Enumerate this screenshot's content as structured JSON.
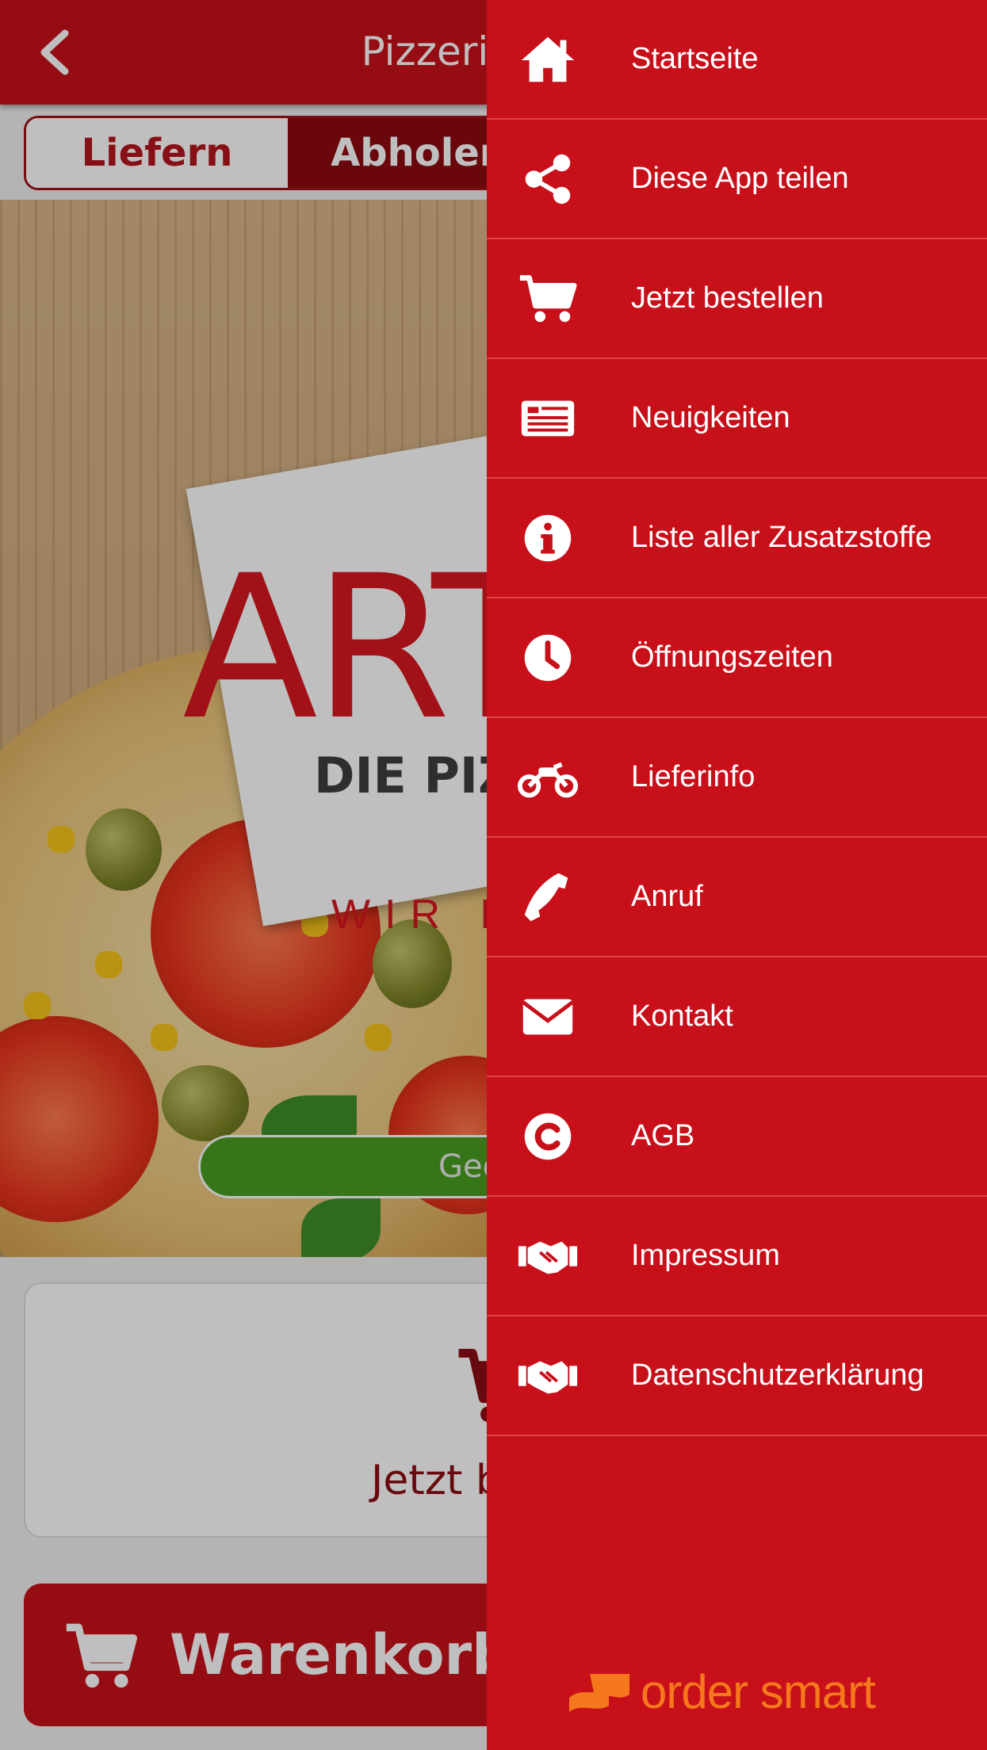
{
  "app": {
    "title": "Pizzeria Artur",
    "toggle": {
      "option_delivery": "Liefern",
      "option_pickup": "Abholen",
      "selected": "Abholen"
    },
    "hero": {
      "logo_text": "ARTUR",
      "logo_subtitle": "DIE PIZZERIA",
      "logo_tagline": "WIR B",
      "status": "Geö"
    },
    "order_card": {
      "label": "Jetzt bestellen",
      "icon": "cart-icon"
    },
    "basket_button": {
      "label": "Warenkorb",
      "icon": "cart-icon"
    }
  },
  "drawer": {
    "items": [
      {
        "label": "Startseite",
        "icon": "home-icon"
      },
      {
        "label": "Diese App teilen",
        "icon": "share-icon"
      },
      {
        "label": "Jetzt bestellen",
        "icon": "cart-icon"
      },
      {
        "label": "Neuigkeiten",
        "icon": "newspaper-icon"
      },
      {
        "label": "Liste aller Zusatzstoffe",
        "icon": "info-icon"
      },
      {
        "label": "Öffnungszeiten",
        "icon": "clock-icon"
      },
      {
        "label": "Lieferinfo",
        "icon": "motorcycle-icon"
      },
      {
        "label": "Anruf",
        "icon": "phone-icon"
      },
      {
        "label": "Kontakt",
        "icon": "envelope-icon"
      },
      {
        "label": "AGB",
        "icon": "copyright-icon"
      },
      {
        "label": "Impressum",
        "icon": "handshake-icon"
      },
      {
        "label": "Datenschutzerklärung",
        "icon": "handshake-icon"
      }
    ],
    "brand": {
      "text": "order smart",
      "color": "#f5781c"
    }
  },
  "colors": {
    "primary": "#c8101a",
    "dark": "#8d0a10",
    "open_green": "#4a9e20"
  }
}
